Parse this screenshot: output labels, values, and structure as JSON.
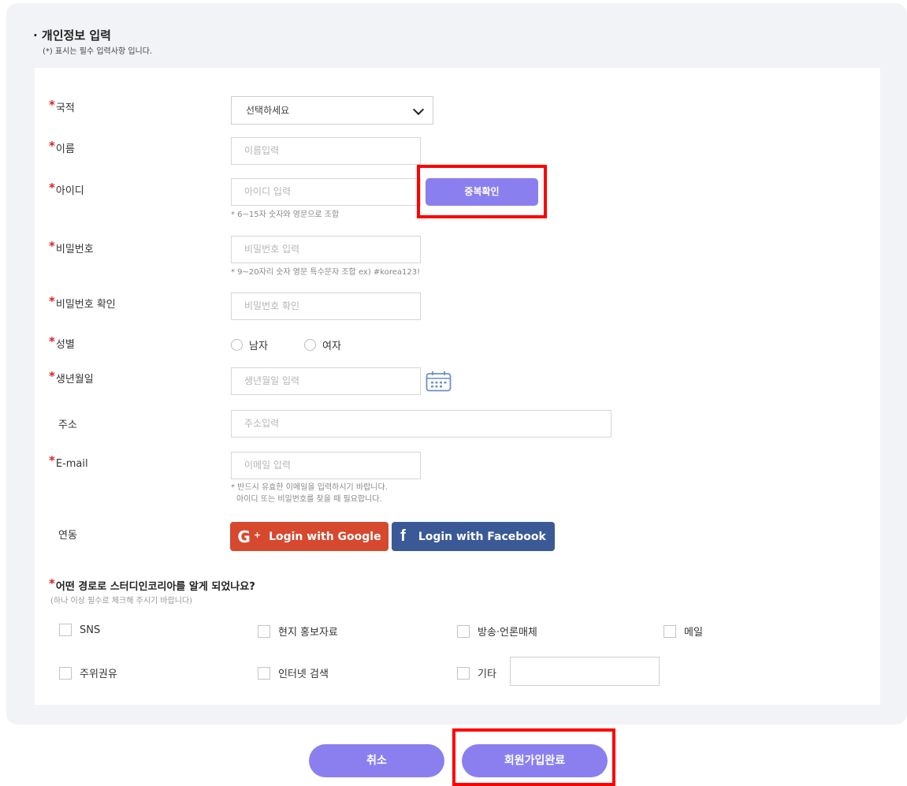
{
  "section": {
    "title": "· 개인정보 입력",
    "subtitle": "(*) 표시는 필수 입력사항 입니다."
  },
  "labels": {
    "nationality": "국적",
    "name": "이름",
    "user_id": "아이디",
    "password": "비밀번호",
    "password_confirm": "비밀번호 확인",
    "gender": "성별",
    "birthdate": "생년월일",
    "address": "주소",
    "email": "E-mail",
    "link": "연동"
  },
  "nationality_select": {
    "value": "선택하세요"
  },
  "placeholders": {
    "name": "이름입력",
    "user_id": "아이디 입력",
    "password": "비밀번호 입력",
    "password_confirm": "비밀번호 확인",
    "birthdate": "생년월일 입력",
    "address": "주소입력",
    "email": "이메일 입력"
  },
  "hints": {
    "user_id": "* 6~15자 숫자와 영문으로 조합",
    "password": "* 9~20자리 숫자 영문 특수문자 조합 ex) #korea123!",
    "email_line1": "* 반드시 유효한 이메일을 입력하시기 바랍니다.",
    "email_line2": "아이디 또는 비밀번호를 찾을 때 필요합니다."
  },
  "buttons": {
    "duplicate_check": "중복확인",
    "google_login": "Login with Google",
    "facebook_login": "Login with Facebook",
    "cancel": "취소",
    "submit": "회원가입완료"
  },
  "gender_options": [
    "남자",
    "여자"
  ],
  "required_mark": "*",
  "question": {
    "title": "어떤 경로로 스터디인코리아를 알게 되었나요?",
    "subtitle": "(하나 이상 필수로 체크해 주시기 바랍니다)",
    "options": [
      "SNS",
      "현지 홍보자료",
      "방송·언론매체",
      "메일",
      "주위권유",
      "인터넷 검색",
      "기타"
    ]
  },
  "icons": {
    "google": "G",
    "google_plus": "+",
    "facebook": "f"
  },
  "colors": {
    "accent": "#8b7ff0",
    "required": "#e02020",
    "google": "#d6492f",
    "facebook": "#3b5997",
    "highlight": "#ff0000"
  }
}
